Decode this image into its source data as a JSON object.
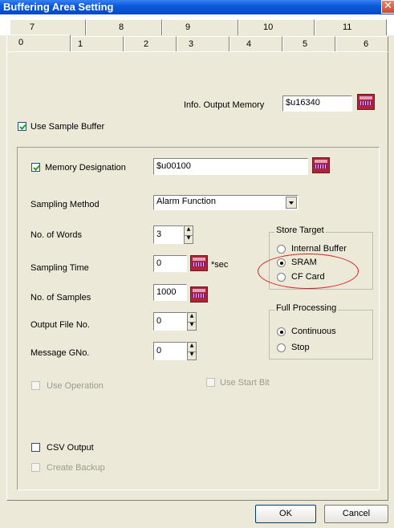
{
  "window": {
    "title": "Buffering Area Setting",
    "close_glyph": "✕"
  },
  "tabs_row_back": [
    "7",
    "8",
    "9",
    "10",
    "11"
  ],
  "tabs_row_front": [
    "0",
    "1",
    "2",
    "3",
    "4",
    "5",
    "6"
  ],
  "active_tab": "0",
  "info_output_memory": {
    "label": "Info. Output Memory",
    "value": "$u16340"
  },
  "use_sample_buffer": {
    "label": "Use Sample Buffer",
    "checked": true
  },
  "memory_designation": {
    "label": "Memory Designation",
    "checked": true,
    "value": "$u00100"
  },
  "sampling_method": {
    "label": "Sampling Method",
    "value": "Alarm Function"
  },
  "no_of_words": {
    "label": "No. of Words",
    "value": "3"
  },
  "sampling_time": {
    "label": "Sampling Time",
    "value": "0",
    "unit": "*sec"
  },
  "no_of_samples": {
    "label": "No. of Samples",
    "value": "1000"
  },
  "output_file_no": {
    "label": "Output File No.",
    "value": "0"
  },
  "message_gno": {
    "label": "Message GNo.",
    "value": "0"
  },
  "store_target": {
    "title": "Store Target",
    "options": [
      "Internal Buffer",
      "SRAM",
      "CF Card"
    ],
    "selected": "SRAM"
  },
  "full_processing": {
    "title": "Full Processing",
    "options": [
      "Continuous",
      "Stop"
    ],
    "selected": "Continuous"
  },
  "use_operation": {
    "label": "Use Operation",
    "checked": false,
    "enabled": false
  },
  "use_start_bit": {
    "label": "Use Start Bit",
    "checked": false,
    "enabled": false
  },
  "csv_output": {
    "label": "CSV Output",
    "checked": false
  },
  "create_backup": {
    "label": "Create Backup",
    "checked": false,
    "enabled": false
  },
  "buttons": {
    "ok": "OK",
    "cancel": "Cancel"
  },
  "colors": {
    "title_bar": "#0a5bdc",
    "dialog_bg": "#ece9d8",
    "highlight_ellipse": "#d72020",
    "memory_icon": "#b0243a"
  },
  "icons": {
    "memory_picker": "memory-picker-icon",
    "dropdown": "dropdown-arrow-icon",
    "check": "check-mark-icon"
  }
}
